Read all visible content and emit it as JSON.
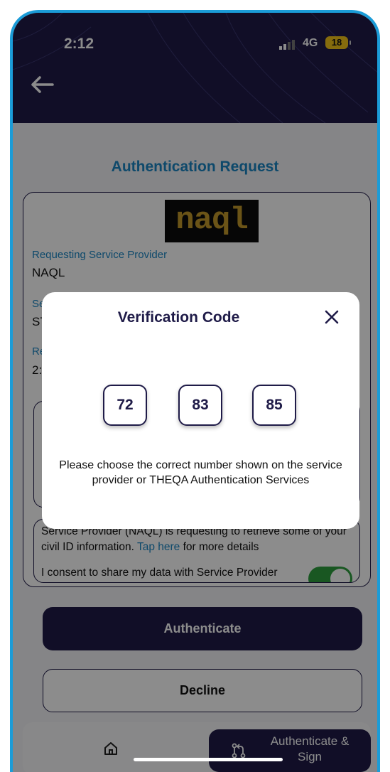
{
  "status_bar": {
    "time": "2:12",
    "network": "4G",
    "battery": "18"
  },
  "page": {
    "title": "Authentication Request"
  },
  "provider": {
    "logo_text": "naql",
    "requesting_label": "Requesting Service Provider",
    "requesting_value": "NAQL",
    "service_label_partial": "Se",
    "service_value_partial": "ST",
    "reason_label_partial": "Re",
    "reason_value_partial": "2:"
  },
  "consent": {
    "text_before": "Service Provider (NAQL) is requesting to retrieve some of your civil ID information. ",
    "link": "Tap here",
    "text_after": " for more details",
    "partial_line": "I consent to share my data with Service Provider",
    "toggle_on": true
  },
  "buttons": {
    "authenticate": "Authenticate",
    "decline": "Decline"
  },
  "tabbar": {
    "home_icon": "home-icon",
    "active_tab": "Authenticate & Sign"
  },
  "modal": {
    "title": "Verification Code",
    "codes": [
      "72",
      "83",
      "85"
    ],
    "instruction": "Please choose the correct number shown on the service provider or THEQA Authentication Services"
  },
  "colors": {
    "navy": "#1f1b48",
    "accent_blue": "#1a86c4",
    "frame": "#1b9cd8",
    "toggle_green": "#2e9e3e"
  }
}
